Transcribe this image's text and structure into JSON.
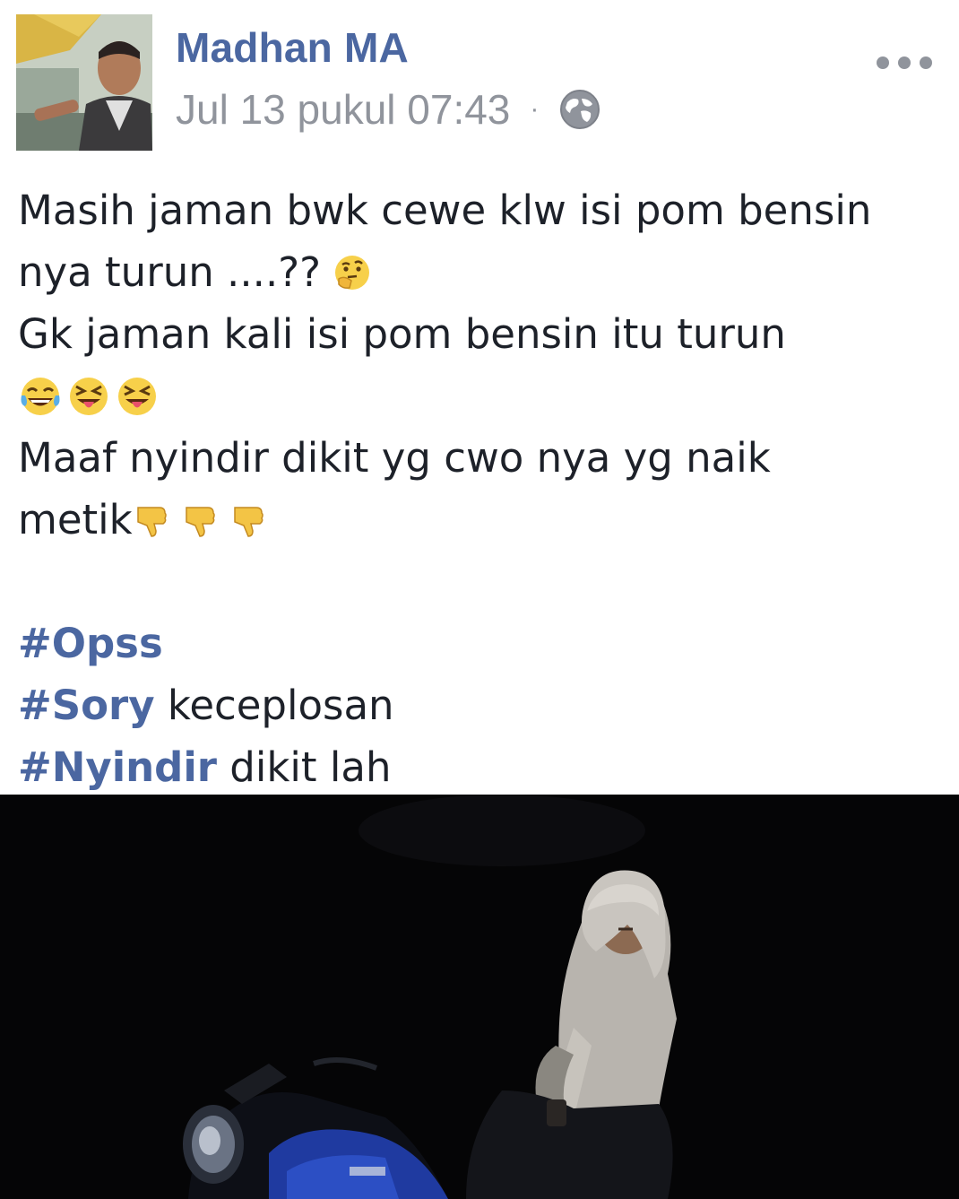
{
  "post": {
    "author": "Madhan MA",
    "timestamp": "Jul 13 pukul 07:43",
    "separator": "·",
    "privacy_icon": "globe-icon",
    "more_icon": "more-options-icon",
    "lines": {
      "l1": "Masih jaman bwk cewe klw isi pom bensin",
      "l2": "nya turun ....??",
      "l3": "Gk jaman kali isi pom bensin itu turun",
      "l5": "Maaf nyindir dikit yg cwo nya yg naik",
      "l6": "metik"
    },
    "emojis": {
      "thinking": "thinking-face-emoji",
      "laughing": [
        "tears-of-joy-emoji",
        "squinting-tongue-emoji",
        "squinting-tongue-emoji"
      ],
      "thumbs": [
        "thumbs-down-emoji",
        "thumbs-down-emoji",
        "thumbs-down-emoji"
      ]
    },
    "hashtags": [
      {
        "tag": "#Opss",
        "text": ""
      },
      {
        "tag": "#Sory",
        "text": " keceplosan"
      },
      {
        "tag": "#Nyindir",
        "text": " dikit lah"
      }
    ],
    "photo": "night-photo-woman-on-motorcycle"
  },
  "colors": {
    "link": "#4b67a1",
    "meta": "#90949c",
    "text": "#1d2129",
    "photo_bg": "#050506"
  }
}
